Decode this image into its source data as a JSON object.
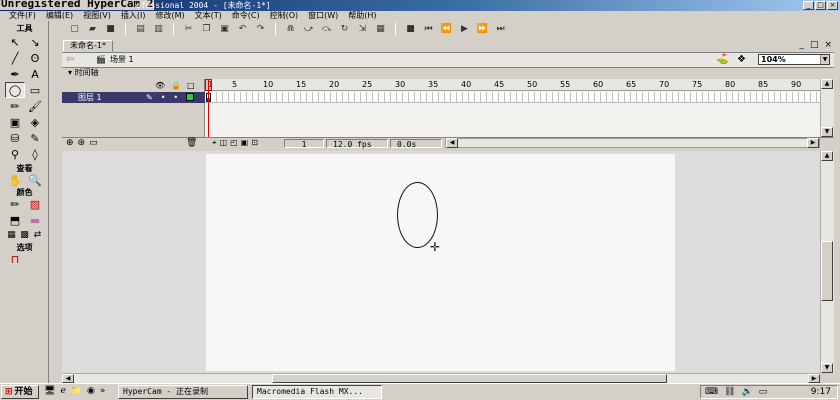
{
  "window": {
    "watermark": "Unregistered HyperCam 2",
    "title_rest": "ofessional 2004 - [未命名-1*]",
    "controls": [
      "_",
      "□",
      "×"
    ]
  },
  "menu": [
    "文件(F)",
    "编辑(E)",
    "视图(V)",
    "插入(I)",
    "修改(M)",
    "文本(T)",
    "命令(C)",
    "控制(O)",
    "窗口(W)",
    "帮助(H)"
  ],
  "tools": {
    "header": "工具",
    "view_header": "查看",
    "colors_header": "颜色",
    "options_header": "选项",
    "items": [
      "↖",
      "↘",
      "╱",
      "ʘ",
      "✒",
      "A",
      "◯",
      "▭",
      "✏",
      "🖌",
      "▣",
      "◈",
      "⛁",
      "✎",
      "⚲",
      "◊"
    ],
    "view": [
      "✋",
      "🔍"
    ],
    "colors": [
      "✏",
      "▨",
      "⬒",
      "▬"
    ],
    "color_swatches": [
      "▦",
      "▩",
      "⇄"
    ],
    "options": [
      "⊓"
    ]
  },
  "document": {
    "tab": "未命名-1*",
    "scene": "场景 1",
    "zoom": "104%",
    "doc_controls": [
      "_",
      "□",
      "×"
    ]
  },
  "timeline": {
    "header": "时间轴",
    "layer_name": "图层 1",
    "ruler": [
      "1",
      "5",
      "10",
      "15",
      "20",
      "25",
      "30",
      "35",
      "40",
      "45",
      "50",
      "55",
      "60",
      "65",
      "70",
      "75",
      "80",
      "85",
      "90"
    ],
    "current_frame": "1",
    "fps": "12.0 fps",
    "elapsed": "0.0s"
  },
  "taskbar": {
    "start": "开始",
    "tasks": [
      "HyperCam - 正在录制",
      "Macromedia Flash MX..."
    ],
    "clock": "9:17"
  }
}
